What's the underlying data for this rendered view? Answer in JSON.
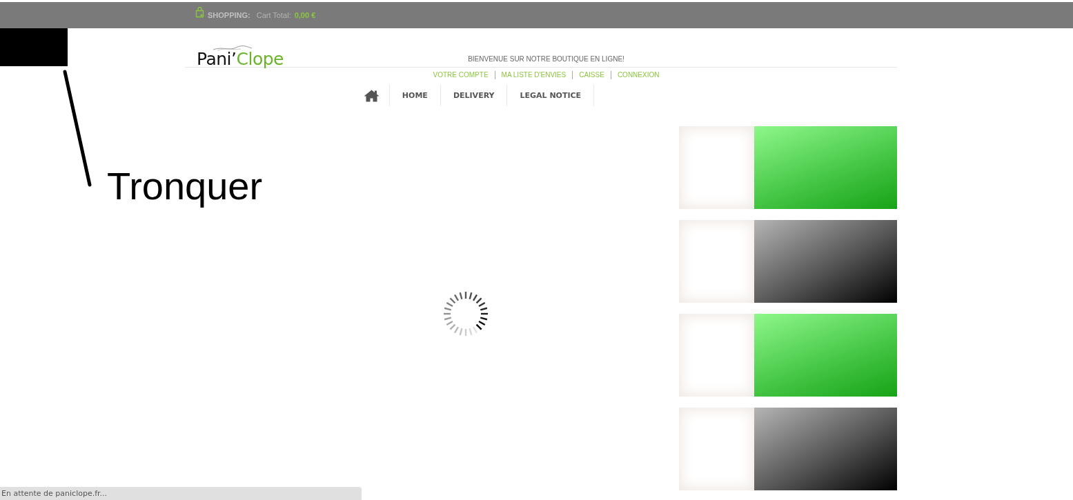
{
  "top_bar": {
    "label": "SHOPPING:",
    "cart_label": "Cart Total:",
    "cart_total": "0,00 €"
  },
  "header": {
    "logo": {
      "dark": "Pani’",
      "light": "Clope"
    },
    "welcome": "BIENVENUE SUR NOTRE BOUTIQUE EN LIGNE!",
    "links": [
      "VOTRE COMPTE",
      "MA LISTE D'ENVIES",
      "CAISSE",
      "CONNEXION"
    ]
  },
  "nav": [
    {
      "kind": "home"
    },
    {
      "kind": "text",
      "label": "HOME"
    },
    {
      "kind": "text",
      "label": "DELIVERY"
    },
    {
      "kind": "text",
      "label": "LEGAL NOTICE"
    }
  ],
  "banners": [
    {
      "kind": "green"
    },
    {
      "kind": "dark"
    },
    {
      "kind": "green"
    },
    {
      "kind": "dark"
    }
  ],
  "annotation": {
    "label": "Tronquer"
  },
  "status_bar": "En attente de paniclope.fr..."
}
